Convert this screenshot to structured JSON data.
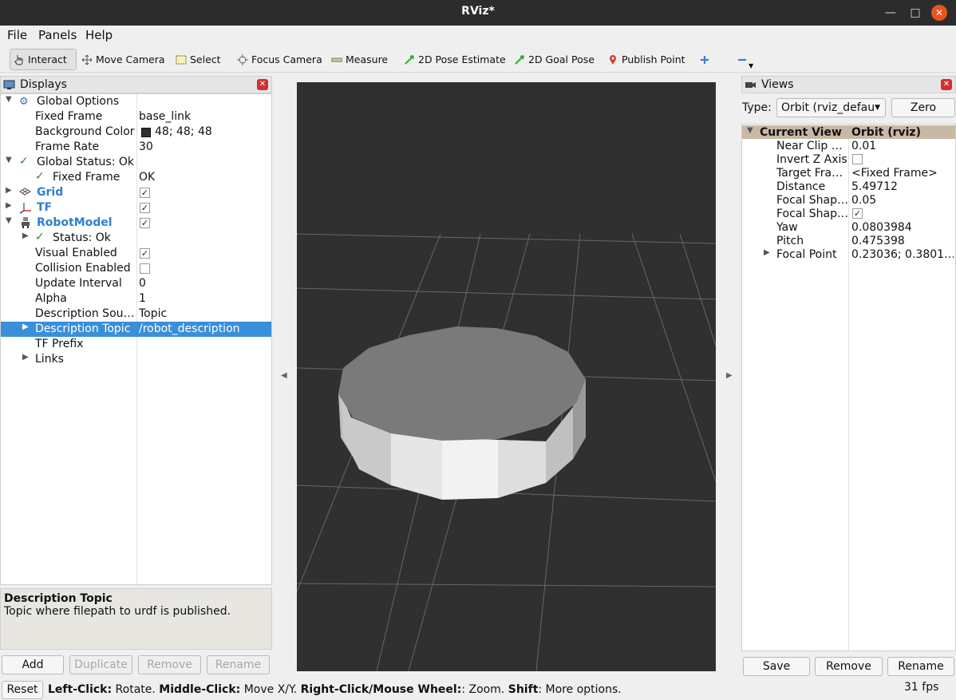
{
  "window": {
    "title": "RViz*"
  },
  "menu": [
    "File",
    "Panels",
    "Help"
  ],
  "toolbar": {
    "interact": "Interact",
    "move_camera": "Move Camera",
    "select": "Select",
    "focus_camera": "Focus Camera",
    "measure": "Measure",
    "pose_estimate": "2D Pose Estimate",
    "goal_pose": "2D Goal Pose",
    "publish_point": "Publish Point"
  },
  "displays": {
    "title": "Displays",
    "rows": {
      "global_options": "Global Options",
      "fixed_frame_k": "Fixed Frame",
      "fixed_frame_v": "base_link",
      "bg_color_k": "Background Color",
      "bg_color_v": "48; 48; 48",
      "frame_rate_k": "Frame Rate",
      "frame_rate_v": "30",
      "global_status": "Global Status: Ok",
      "status_fixed_frame_k": "Fixed Frame",
      "status_fixed_frame_v": "OK",
      "grid": "Grid",
      "tf": "TF",
      "robot_model": "RobotModel",
      "rm_status": "Status: Ok",
      "visual_enabled": "Visual Enabled",
      "collision_enabled": "Collision Enabled",
      "update_interval_k": "Update Interval",
      "update_interval_v": "0",
      "alpha_k": "Alpha",
      "alpha_v": "1",
      "desc_source_k": "Description Sou…",
      "desc_source_v": "Topic",
      "desc_topic_k": "Description Topic",
      "desc_topic_v": "/robot_description",
      "tf_prefix": "TF Prefix",
      "links": "Links"
    },
    "background_color_hex": "#303030"
  },
  "description": {
    "title": "Description Topic",
    "text": "Topic where filepath to urdf is published."
  },
  "display_buttons": {
    "add": "Add",
    "duplicate": "Duplicate",
    "remove": "Remove",
    "rename": "Rename"
  },
  "views": {
    "title": "Views",
    "type_label": "Type:",
    "type_value": "Orbit (rviz_defau",
    "zero": "Zero",
    "header_k": "Current View",
    "header_v": "Orbit (rviz)",
    "props": [
      {
        "k": "Near Clip …",
        "v": "0.01"
      },
      {
        "k": "Invert Z Axis",
        "v": ""
      },
      {
        "k": "Target Fra…",
        "v": "<Fixed Frame>"
      },
      {
        "k": "Distance",
        "v": "5.49712"
      },
      {
        "k": "Focal Shap…",
        "v": "0.05"
      },
      {
        "k": "Focal Shap…",
        "v": ""
      },
      {
        "k": "Yaw",
        "v": "0.0803984"
      },
      {
        "k": "Pitch",
        "v": "0.475398"
      },
      {
        "k": "Focal Point",
        "v": "0.23036; 0.3801…"
      }
    ],
    "save": "Save",
    "remove": "Remove",
    "rename": "Rename"
  },
  "status_bar": {
    "reset": "Reset",
    "left_click": "Left-Click:",
    "left_click_desc": " Rotate. ",
    "middle_click": "Middle-Click:",
    "middle_click_desc": " Move X/Y. ",
    "right_click": "Right-Click/Mouse Wheel:",
    "right_click_desc": ": Zoom. ",
    "shift": "Shift",
    "shift_desc": ": More options.",
    "fps": "31 fps"
  }
}
